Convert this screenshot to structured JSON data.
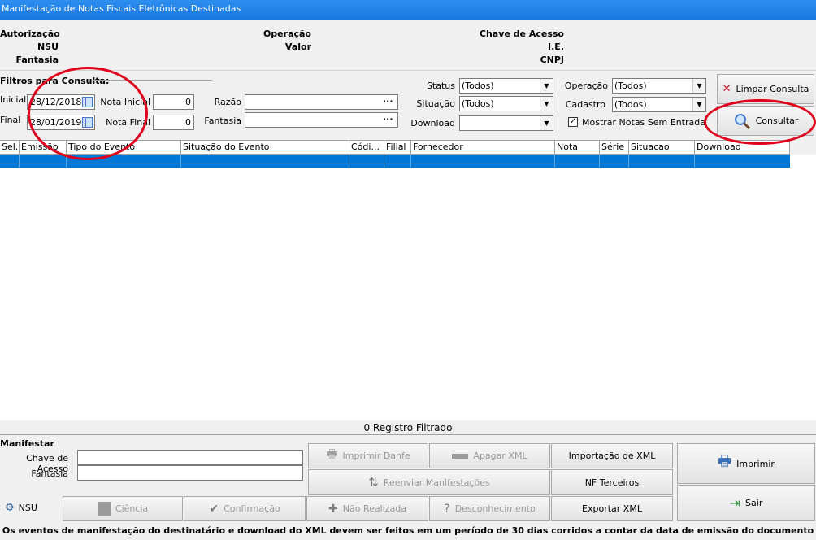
{
  "window": {
    "title": "Manifestação de Notas Fiscais Eletrônicas Destinadas"
  },
  "info": {
    "autorizacao": "Autorização",
    "nsu": "NSU",
    "fantasia": "Fantasia",
    "operacao": "Operação",
    "valor": "Valor",
    "chave": "Chave de Acesso",
    "ie": "I.E.",
    "cnpj": "CNPJ"
  },
  "filters": {
    "group_label": "Filtros para Consulta:",
    "inicial_label": "Inicial",
    "inicial_value": "28/12/2018",
    "final_label": "Final",
    "final_value": "28/01/2019",
    "nota_inicial_label": "Nota Inicial",
    "nota_inicial_value": "0",
    "nota_final_label": "Nota Final",
    "nota_final_value": "0",
    "razao_label": "Razão",
    "fantasia_label": "Fantasia",
    "ellipsis": "···",
    "status_label": "Status",
    "status_value": "(Todos)",
    "situacao_label": "Situação",
    "situacao_value": "(Todos)",
    "download_label": "Download",
    "download_value": "",
    "operacao_label": "Operação",
    "operacao_value": "(Todos)",
    "cadastro_label": "Cadastro",
    "cadastro_value": "(Todos)",
    "mostrar_label": "Mostrar Notas Sem Entrada",
    "mostrar_checked": true
  },
  "actions": {
    "limpar": "Limpar Consulta",
    "consultar": "Consultar"
  },
  "grid": {
    "columns": [
      "Sel.",
      "Emissão",
      "Tipo do Evento",
      "Situação do Evento",
      "Códi...",
      "Filial",
      "Fornecedor",
      "Nota",
      "Série",
      "Situacao",
      "Download"
    ],
    "status": "0 Registro Filtrado"
  },
  "manifest": {
    "label": "Manifestar",
    "chave_label": "Chave de Acesso",
    "fantasia_label": "Fantasia",
    "chave_value": "",
    "fantasia_value": ""
  },
  "buttons": {
    "imprimir_danfe": "Imprimir Danfe",
    "apagar_xml": "Apagar XML",
    "importacao_xml": "Importação de XML",
    "imprimir": "Imprimir",
    "reenviar": "Reenviar Manifestações",
    "nf_terceiros": "NF Terceiros",
    "nsu": "NSU",
    "ciencia": "Ciência",
    "confirmacao": "Confirmação",
    "nao_realizada": "Não Realizada",
    "desconhecimento": "Desconhecimento",
    "exportar_xml": "Exportar XML",
    "sair": "Sair"
  },
  "footer": {
    "note": "Os eventos de manifestação do destinatário e download do XML devem ser feitos em um período de 30 dias corridos a contar da data de emissão do documento"
  },
  "colors": {
    "title_bar": "#1a79e0",
    "selection": "#0078d7",
    "annotation": "#e0001b"
  }
}
